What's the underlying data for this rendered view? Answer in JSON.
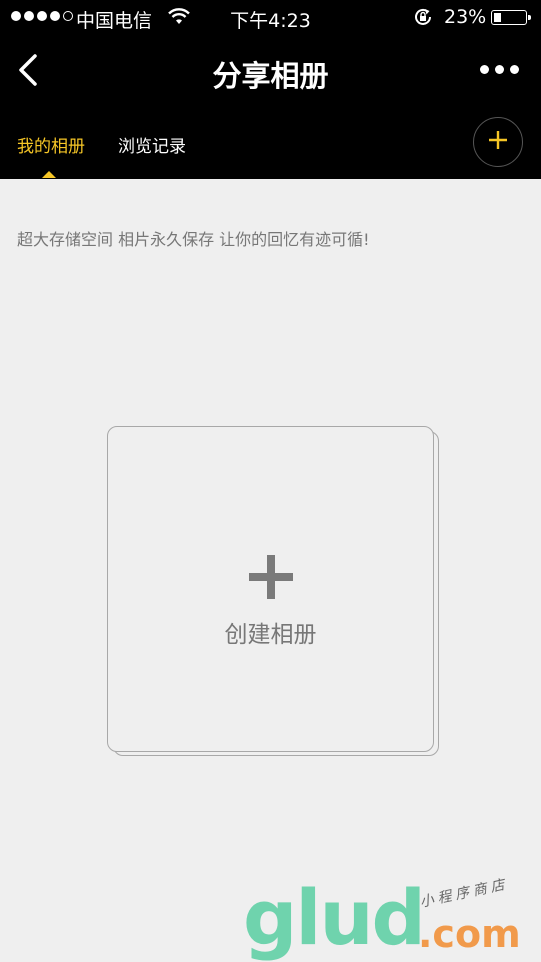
{
  "status_bar": {
    "carrier": "中国电信",
    "time": "下午4:23",
    "battery_percent": "23%",
    "battery_level": 0.23,
    "signal_bars_filled": 4,
    "signal_bars_total": 5
  },
  "nav": {
    "title": "分享相册"
  },
  "tabs": [
    {
      "label": "我的相册",
      "active": true
    },
    {
      "label": "浏览记录",
      "active": false
    }
  ],
  "tagline": "超大存储空间 相片永久保存 让你的回忆有迹可循!",
  "create_card": {
    "label": "创建相册"
  },
  "watermark": {
    "brand": "glud",
    "domain": ".com",
    "tag": "小程序商店"
  },
  "colors": {
    "accent": "#f6c626",
    "header_bg": "#000000",
    "page_bg": "#efefef",
    "watermark_green": "#6fd3ad",
    "watermark_orange": "#f19a4b"
  }
}
